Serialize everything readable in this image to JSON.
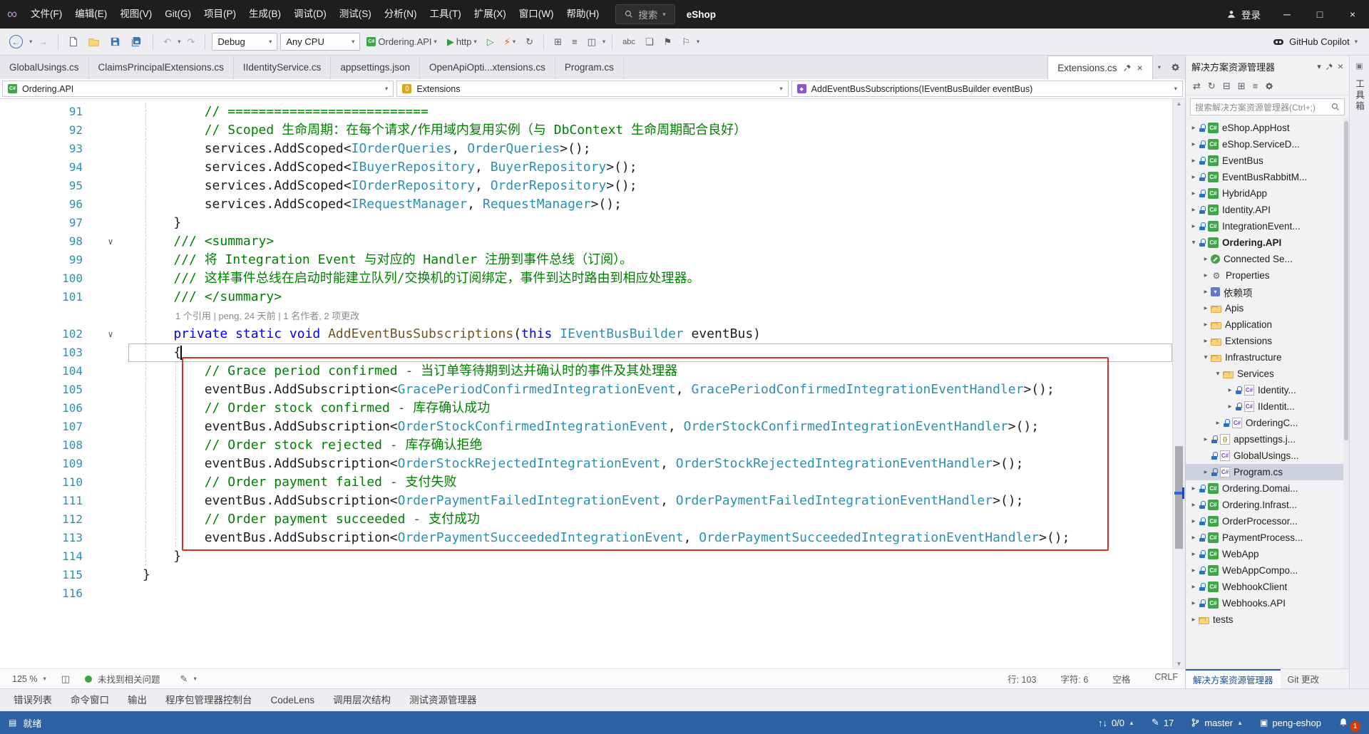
{
  "titlebar": {
    "logo_glyph": "∞",
    "menus": [
      "文件(F)",
      "编辑(E)",
      "视图(V)",
      "Git(G)",
      "项目(P)",
      "生成(B)",
      "调试(D)",
      "测试(S)",
      "分析(N)",
      "工具(T)",
      "扩展(X)",
      "窗口(W)",
      "帮助(H)"
    ],
    "search_label": "搜索",
    "solution_name": "eShop",
    "signin_label": "登录",
    "window_controls": {
      "minimize": "─",
      "maximize": "□",
      "close": "×"
    }
  },
  "toolbar": {
    "config": "Debug",
    "platform": "Any CPU",
    "run_target": "Ordering.API",
    "profile": "http",
    "copilot_label": "GitHub Copilot"
  },
  "tab_bar": {
    "tabs": [
      "GlobalUsings.cs",
      "ClaimsPrincipalExtensions.cs",
      "IIdentityService.cs",
      "appsettings.json",
      "OpenApiOpti...xtensions.cs",
      "Program.cs"
    ],
    "active_tab": "Extensions.cs"
  },
  "navbar": {
    "project": "Ordering.API",
    "type": "Extensions",
    "member": "AddEventBusSubscriptions(IEventBusBuilder eventBus)"
  },
  "editor": {
    "rows": [
      {
        "n": "91",
        "segs": [
          [
            "c",
            "        // =========================="
          ]
        ]
      },
      {
        "n": "92",
        "segs": [
          [
            "c",
            "        // Scoped 生命周期：在每个请求/作用域内复用实例（与 DbContext 生命周期配合良好）"
          ]
        ]
      },
      {
        "n": "93",
        "segs": [
          [
            "p",
            "        services.AddScoped<"
          ],
          [
            "t",
            "IOrderQueries"
          ],
          [
            "p",
            ", "
          ],
          [
            "t",
            "OrderQueries"
          ],
          [
            "p",
            ">();"
          ]
        ]
      },
      {
        "n": "94",
        "segs": [
          [
            "p",
            "        services.AddScoped<"
          ],
          [
            "t",
            "IBuyerRepository"
          ],
          [
            "p",
            ", "
          ],
          [
            "t",
            "BuyerRepository"
          ],
          [
            "p",
            ">();"
          ]
        ]
      },
      {
        "n": "95",
        "segs": [
          [
            "p",
            "        services.AddScoped<"
          ],
          [
            "t",
            "IOrderRepository"
          ],
          [
            "p",
            ", "
          ],
          [
            "t",
            "OrderRepository"
          ],
          [
            "p",
            ">();"
          ]
        ]
      },
      {
        "n": "96",
        "segs": [
          [
            "p",
            "        services.AddScoped<"
          ],
          [
            "t",
            "IRequestManager"
          ],
          [
            "p",
            ", "
          ],
          [
            "t",
            "RequestManager"
          ],
          [
            "p",
            ">();"
          ]
        ]
      },
      {
        "n": "97",
        "segs": [
          [
            "p",
            "    }"
          ]
        ]
      },
      {
        "n": "98",
        "fold": "∨",
        "segs": [
          [
            "c",
            "    /// <summary>"
          ]
        ]
      },
      {
        "n": "99",
        "segs": [
          [
            "c",
            "    /// 将 Integration Event 与对应的 Handler 注册到事件总线（订阅）。"
          ]
        ]
      },
      {
        "n": "100",
        "segs": [
          [
            "c",
            "    /// 这样事件总线在启动时能建立队列/交换机的订阅绑定，事件到达时路由到相应处理器。"
          ]
        ]
      },
      {
        "n": "101",
        "segs": [
          [
            "c",
            "    /// </summary>"
          ]
        ]
      },
      {
        "type": "cl",
        "segs": [
          [
            "cl",
            "1 个引用 | peng, 24 天前 | 1 名作者, 2 项更改"
          ]
        ]
      },
      {
        "n": "102",
        "fold": "∨",
        "segs": [
          [
            "k",
            "    private static void "
          ],
          [
            "m",
            "AddEventBusSubscriptions"
          ],
          [
            "p",
            "("
          ],
          [
            "k",
            "this"
          ],
          [
            "p",
            " "
          ],
          [
            "t",
            "IEventBusBuilder"
          ],
          [
            "p",
            " eventBus)"
          ]
        ]
      },
      {
        "n": "103",
        "current": true,
        "segs": [
          [
            "p",
            "    {"
          ]
        ]
      },
      {
        "n": "104",
        "segs": [
          [
            "c",
            "        // Grace period confirmed - 当订单等待期到达并确认时的事件及其处理器"
          ]
        ]
      },
      {
        "n": "105",
        "segs": [
          [
            "p",
            "        eventBus.AddSubscription<"
          ],
          [
            "t",
            "GracePeriodConfirmedIntegrationEvent"
          ],
          [
            "p",
            ", "
          ],
          [
            "t",
            "GracePeriodConfirmedIntegrationEventHandler"
          ],
          [
            "p",
            ">();"
          ]
        ]
      },
      {
        "n": "106",
        "segs": [
          [
            "c",
            "        // Order stock confirmed - 库存确认成功"
          ]
        ]
      },
      {
        "n": "107",
        "segs": [
          [
            "p",
            "        eventBus.AddSubscription<"
          ],
          [
            "t",
            "OrderStockConfirmedIntegrationEvent"
          ],
          [
            "p",
            ", "
          ],
          [
            "t",
            "OrderStockConfirmedIntegrationEventHandler"
          ],
          [
            "p",
            ">();"
          ]
        ]
      },
      {
        "n": "108",
        "segs": [
          [
            "c",
            "        // Order stock rejected - 库存确认拒绝"
          ]
        ]
      },
      {
        "n": "109",
        "segs": [
          [
            "p",
            "        eventBus.AddSubscription<"
          ],
          [
            "t",
            "OrderStockRejectedIntegrationEvent"
          ],
          [
            "p",
            ", "
          ],
          [
            "t",
            "OrderStockRejectedIntegrationEventHandler"
          ],
          [
            "p",
            ">();"
          ]
        ]
      },
      {
        "n": "110",
        "segs": [
          [
            "c",
            "        // Order payment failed - 支付失败"
          ]
        ]
      },
      {
        "n": "111",
        "segs": [
          [
            "p",
            "        eventBus.AddSubscription<"
          ],
          [
            "t",
            "OrderPaymentFailedIntegrationEvent"
          ],
          [
            "p",
            ", "
          ],
          [
            "t",
            "OrderPaymentFailedIntegrationEventHandler"
          ],
          [
            "p",
            ">();"
          ]
        ]
      },
      {
        "n": "112",
        "segs": [
          [
            "c",
            "        // Order payment succeeded - 支付成功"
          ]
        ]
      },
      {
        "n": "113",
        "segs": [
          [
            "p",
            "        eventBus.AddSubscription<"
          ],
          [
            "t",
            "OrderPaymentSucceededIntegrationEvent"
          ],
          [
            "p",
            ", "
          ],
          [
            "t",
            "OrderPaymentSucceededIntegrationEventHandler"
          ],
          [
            "p",
            ">();"
          ]
        ]
      },
      {
        "n": "114",
        "segs": [
          [
            "p",
            "    }"
          ]
        ]
      },
      {
        "n": "115",
        "segs": [
          [
            "p",
            "}"
          ]
        ]
      },
      {
        "n": "116",
        "segs": []
      }
    ],
    "status": {
      "zoom": "125 %",
      "health": "未找到相关问题",
      "line": "行: 103",
      "char": "字符: 6",
      "spaces": "空格",
      "eol": "CRLF"
    }
  },
  "solution_explorer": {
    "title": "解决方案资源管理器",
    "search_placeholder": "搜索解决方案资源管理器(Ctrl+;)",
    "items": [
      {
        "label": "eShop.AppHost",
        "level": 0,
        "arrow": "c",
        "icon": "proj",
        "lock": true
      },
      {
        "label": "eShop.ServiceD...",
        "level": 0,
        "arrow": "c",
        "icon": "proj",
        "lock": true
      },
      {
        "label": "EventBus",
        "level": 0,
        "arrow": "c",
        "icon": "proj",
        "lock": true
      },
      {
        "label": "EventBusRabbitM...",
        "level": 0,
        "arrow": "c",
        "icon": "proj",
        "lock": true
      },
      {
        "label": "HybridApp",
        "level": 0,
        "arrow": "c",
        "icon": "proj",
        "lock": true
      },
      {
        "label": "Identity.API",
        "level": 0,
        "arrow": "c",
        "icon": "proj",
        "lock": true
      },
      {
        "label": "IntegrationEvent...",
        "level": 0,
        "arrow": "c",
        "icon": "proj",
        "lock": true
      },
      {
        "label": "Ordering.API",
        "level": 0,
        "arrow": "e",
        "icon": "proj",
        "lock": true,
        "bold": true
      },
      {
        "label": "Connected Se...",
        "level": 1,
        "arrow": "c",
        "icon": "plug"
      },
      {
        "label": "Properties",
        "level": 1,
        "arrow": "c",
        "icon": "wrench"
      },
      {
        "label": "依赖项",
        "level": 1,
        "arrow": "c",
        "icon": "pkg"
      },
      {
        "label": "Apis",
        "level": 1,
        "arrow": "c",
        "icon": "folder"
      },
      {
        "label": "Application",
        "level": 1,
        "arrow": "c",
        "icon": "folder"
      },
      {
        "label": "Extensions",
        "level": 1,
        "arrow": "c",
        "icon": "folder"
      },
      {
        "label": "Infrastructure",
        "level": 1,
        "arrow": "e",
        "icon": "folder"
      },
      {
        "label": "Services",
        "level": 2,
        "arrow": "e",
        "icon": "folder"
      },
      {
        "label": "Identity...",
        "level": 3,
        "arrow": "c",
        "icon": "cs",
        "lock": true
      },
      {
        "label": "IIdentit...",
        "level": 3,
        "arrow": "c",
        "icon": "cs",
        "lock": true
      },
      {
        "label": "OrderingC...",
        "level": 2,
        "arrow": "c",
        "icon": "cs",
        "lock": true
      },
      {
        "label": "appsettings.j...",
        "level": 1,
        "arrow": "c",
        "icon": "json",
        "lock": true
      },
      {
        "label": "GlobalUsings...",
        "level": 1,
        "arrow": "",
        "icon": "cs",
        "lock": true
      },
      {
        "label": "Program.cs",
        "level": 1,
        "arrow": "c",
        "icon": "cs",
        "lock": true,
        "selected": true
      },
      {
        "label": "Ordering.Domai...",
        "level": 0,
        "arrow": "c",
        "icon": "proj",
        "lock": true
      },
      {
        "label": "Ordering.Infrast...",
        "level": 0,
        "arrow": "c",
        "icon": "proj",
        "lock": true
      },
      {
        "label": "OrderProcessor...",
        "level": 0,
        "arrow": "c",
        "icon": "proj",
        "lock": true
      },
      {
        "label": "PaymentProcess...",
        "level": 0,
        "arrow": "c",
        "icon": "proj",
        "lock": true
      },
      {
        "label": "WebApp",
        "level": 0,
        "arrow": "c",
        "icon": "proj",
        "lock": true
      },
      {
        "label": "WebAppCompo...",
        "level": 0,
        "arrow": "c",
        "icon": "proj",
        "lock": true
      },
      {
        "label": "WebhookClient",
        "level": 0,
        "arrow": "c",
        "icon": "proj",
        "lock": true
      },
      {
        "label": "Webhooks.API",
        "level": 0,
        "arrow": "c",
        "icon": "proj",
        "lock": true
      },
      {
        "label": "tests",
        "level": 0,
        "arrow": "c",
        "icon": "folder"
      }
    ],
    "panel_tabs": [
      "解决方案资源管理器",
      "Git 更改"
    ]
  },
  "right_strip_label": "工具箱",
  "bottom_tabs": [
    "错误列表",
    "命令窗口",
    "输出",
    "程序包管理器控制台",
    "CodeLens",
    "调用层次结构",
    "测试资源管理器"
  ],
  "statusbar": {
    "ready": "就绪",
    "sync": "0/0",
    "edits": "17",
    "branch": "master",
    "repo": "peng-eshop",
    "notifications": "1"
  }
}
